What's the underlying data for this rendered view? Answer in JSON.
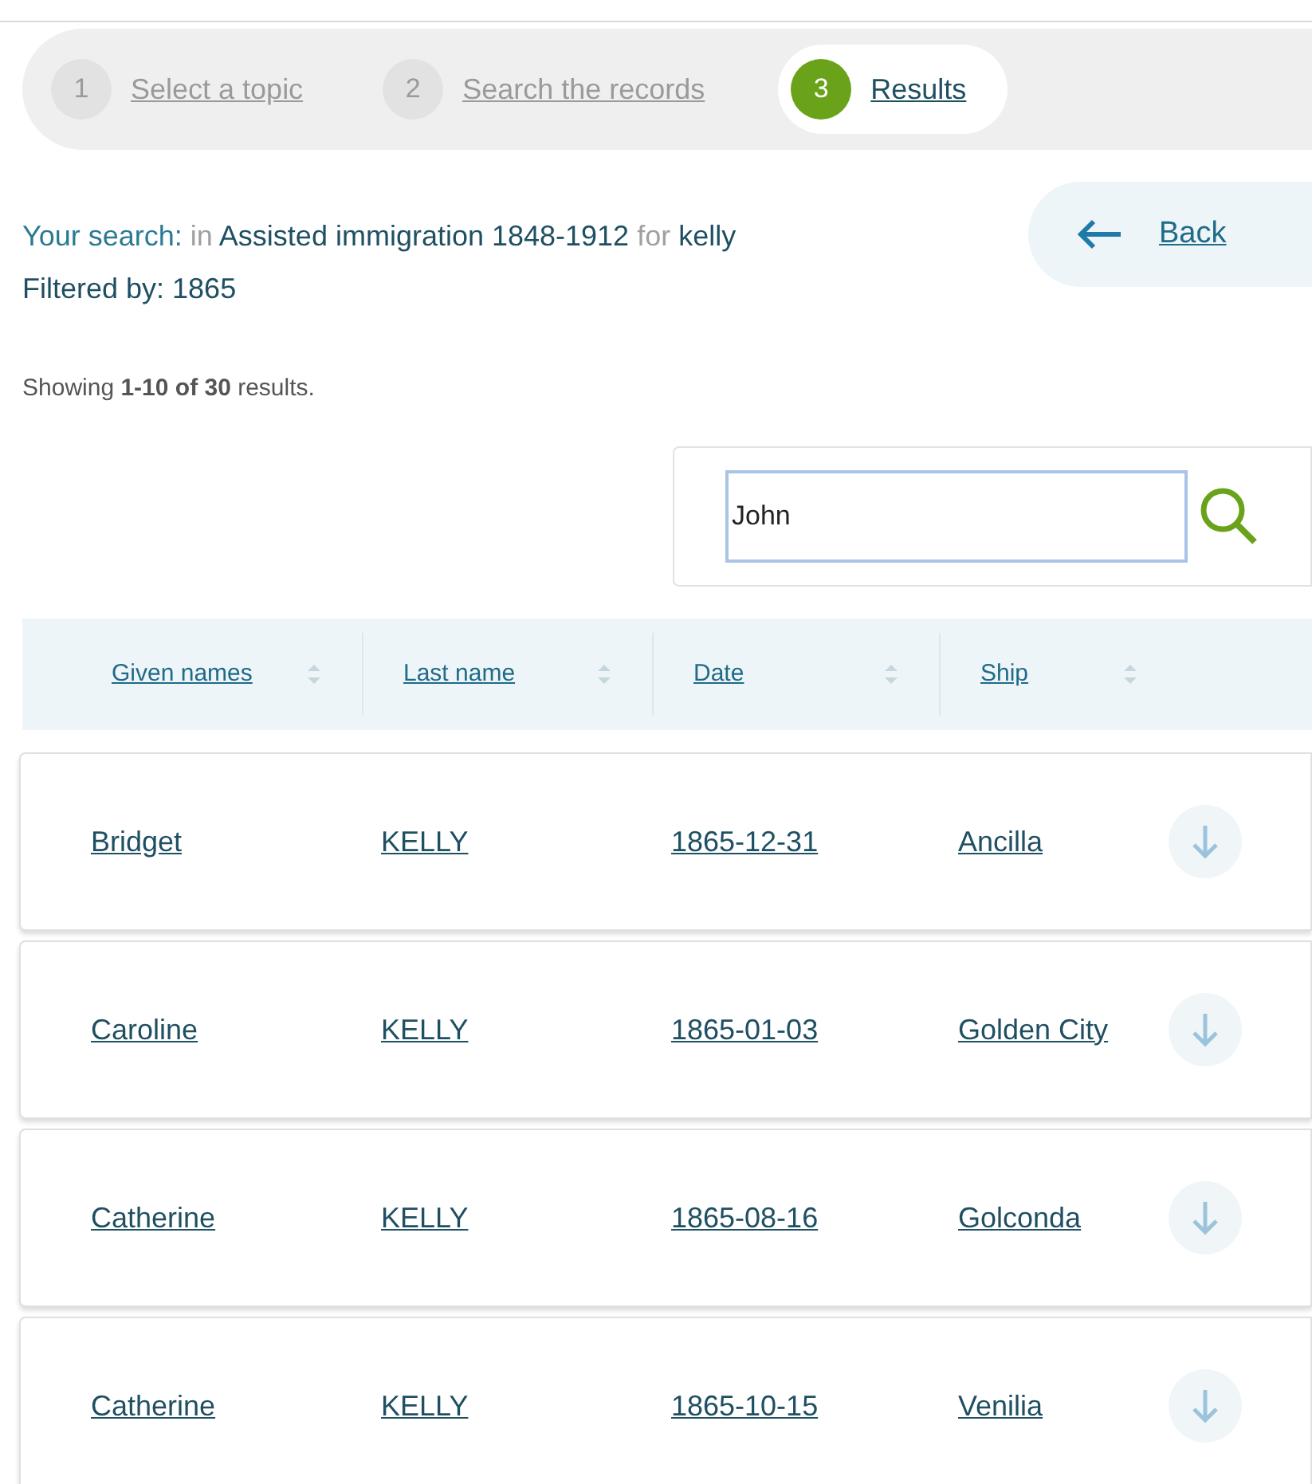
{
  "steps": [
    {
      "number": "1",
      "label": "Select a topic",
      "selected": false
    },
    {
      "number": "2",
      "label": "Search the records",
      "selected": false
    },
    {
      "number": "3",
      "label": "Results",
      "selected": true
    }
  ],
  "search_summary": [
    {
      "text": "Your search:",
      "kind": "label"
    },
    {
      "text": "in",
      "kind": "muted"
    },
    {
      "text": "Assisted immigration 1848-1912",
      "kind": "value"
    },
    {
      "text": "for",
      "kind": "muted"
    },
    {
      "text": "kelly",
      "kind": "value"
    }
  ],
  "filter_line": "Filtered by: 1865",
  "back_button": "Back",
  "result_count": "Showing **1-10 of 30** results.",
  "filter_field": {
    "value": "John"
  },
  "table": {
    "columns": [
      "Given names",
      "Last name",
      "Date",
      "Ship"
    ],
    "rows": [
      {
        "cells": [
          "Bridget",
          "KELLY",
          "1865-12-31",
          "Ancilla"
        ]
      },
      {
        "cells": [
          "Caroline",
          "KELLY",
          "1865-01-03",
          "Golden City"
        ]
      },
      {
        "cells": [
          "Catherine",
          "KELLY",
          "1865-08-16",
          "Golconda"
        ]
      },
      {
        "cells": [
          "Catherine",
          "KELLY",
          "1865-10-15",
          "Venilia"
        ]
      }
    ]
  }
}
